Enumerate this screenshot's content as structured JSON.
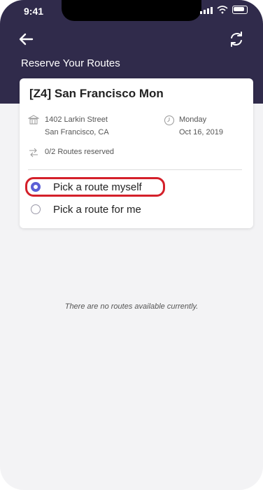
{
  "status_bar": {
    "time": "9:41"
  },
  "header": {
    "title": "Reserve Your Routes",
    "back_icon": "arrow-left-icon",
    "refresh_icon": "refresh-icon"
  },
  "card": {
    "title": "[Z4] San Francisco Mon",
    "address_line1": "1402 Larkin Street",
    "address_line2": "San Francisco, CA",
    "day": "Monday",
    "date": "Oct 16, 2019",
    "routes_reserved": "0/2  Routes reserved",
    "options": [
      {
        "label": "Pick a route myself",
        "selected": true
      },
      {
        "label": "Pick a route for me",
        "selected": false
      }
    ]
  },
  "empty_state": "There are no routes available currently.",
  "colors": {
    "header_bg": "#302b4b",
    "radio_selected": "#5b5fd6",
    "highlight": "#d4202a"
  }
}
